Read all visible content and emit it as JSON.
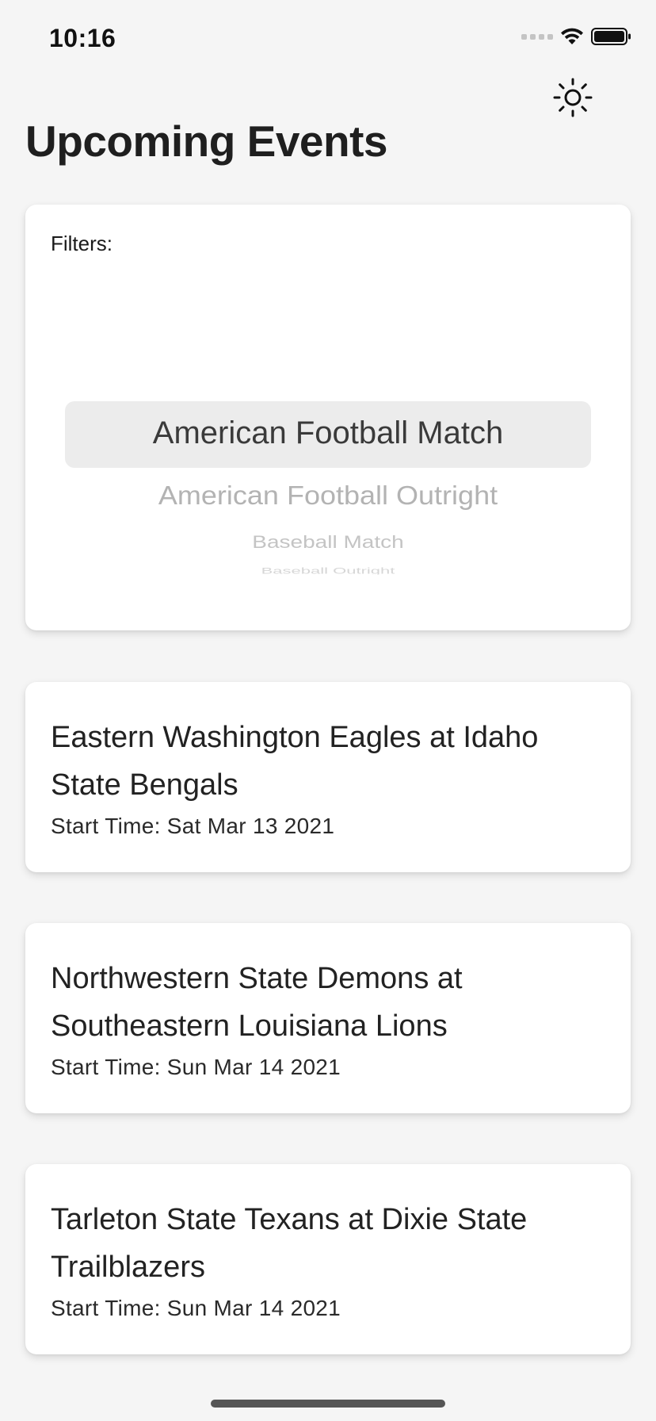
{
  "status_bar": {
    "time": "10:16"
  },
  "header": {
    "title": "Upcoming Events",
    "theme_icon": "sun-icon"
  },
  "filters": {
    "label": "Filters:",
    "selected": "American Football Match",
    "options": [
      "American Football Match",
      "American Football Outright",
      "Baseball Match",
      "Baseball Outright"
    ]
  },
  "events": [
    {
      "title": "Eastern Washington Eagles at Idaho State Bengals",
      "start_time": "Start Time: Sat Mar 13 2021"
    },
    {
      "title": "Northwestern State Demons at Southeastern Louisiana Lions",
      "start_time": "Start Time: Sun Mar 14 2021"
    },
    {
      "title": "Tarleton State Texans at Dixie State Trailblazers",
      "start_time": "Start Time: Sun Mar 14 2021"
    }
  ],
  "colors": {
    "background": "#f5f5f5",
    "card": "#ffffff",
    "text": "#222222",
    "picker_highlight": "#ececec"
  }
}
